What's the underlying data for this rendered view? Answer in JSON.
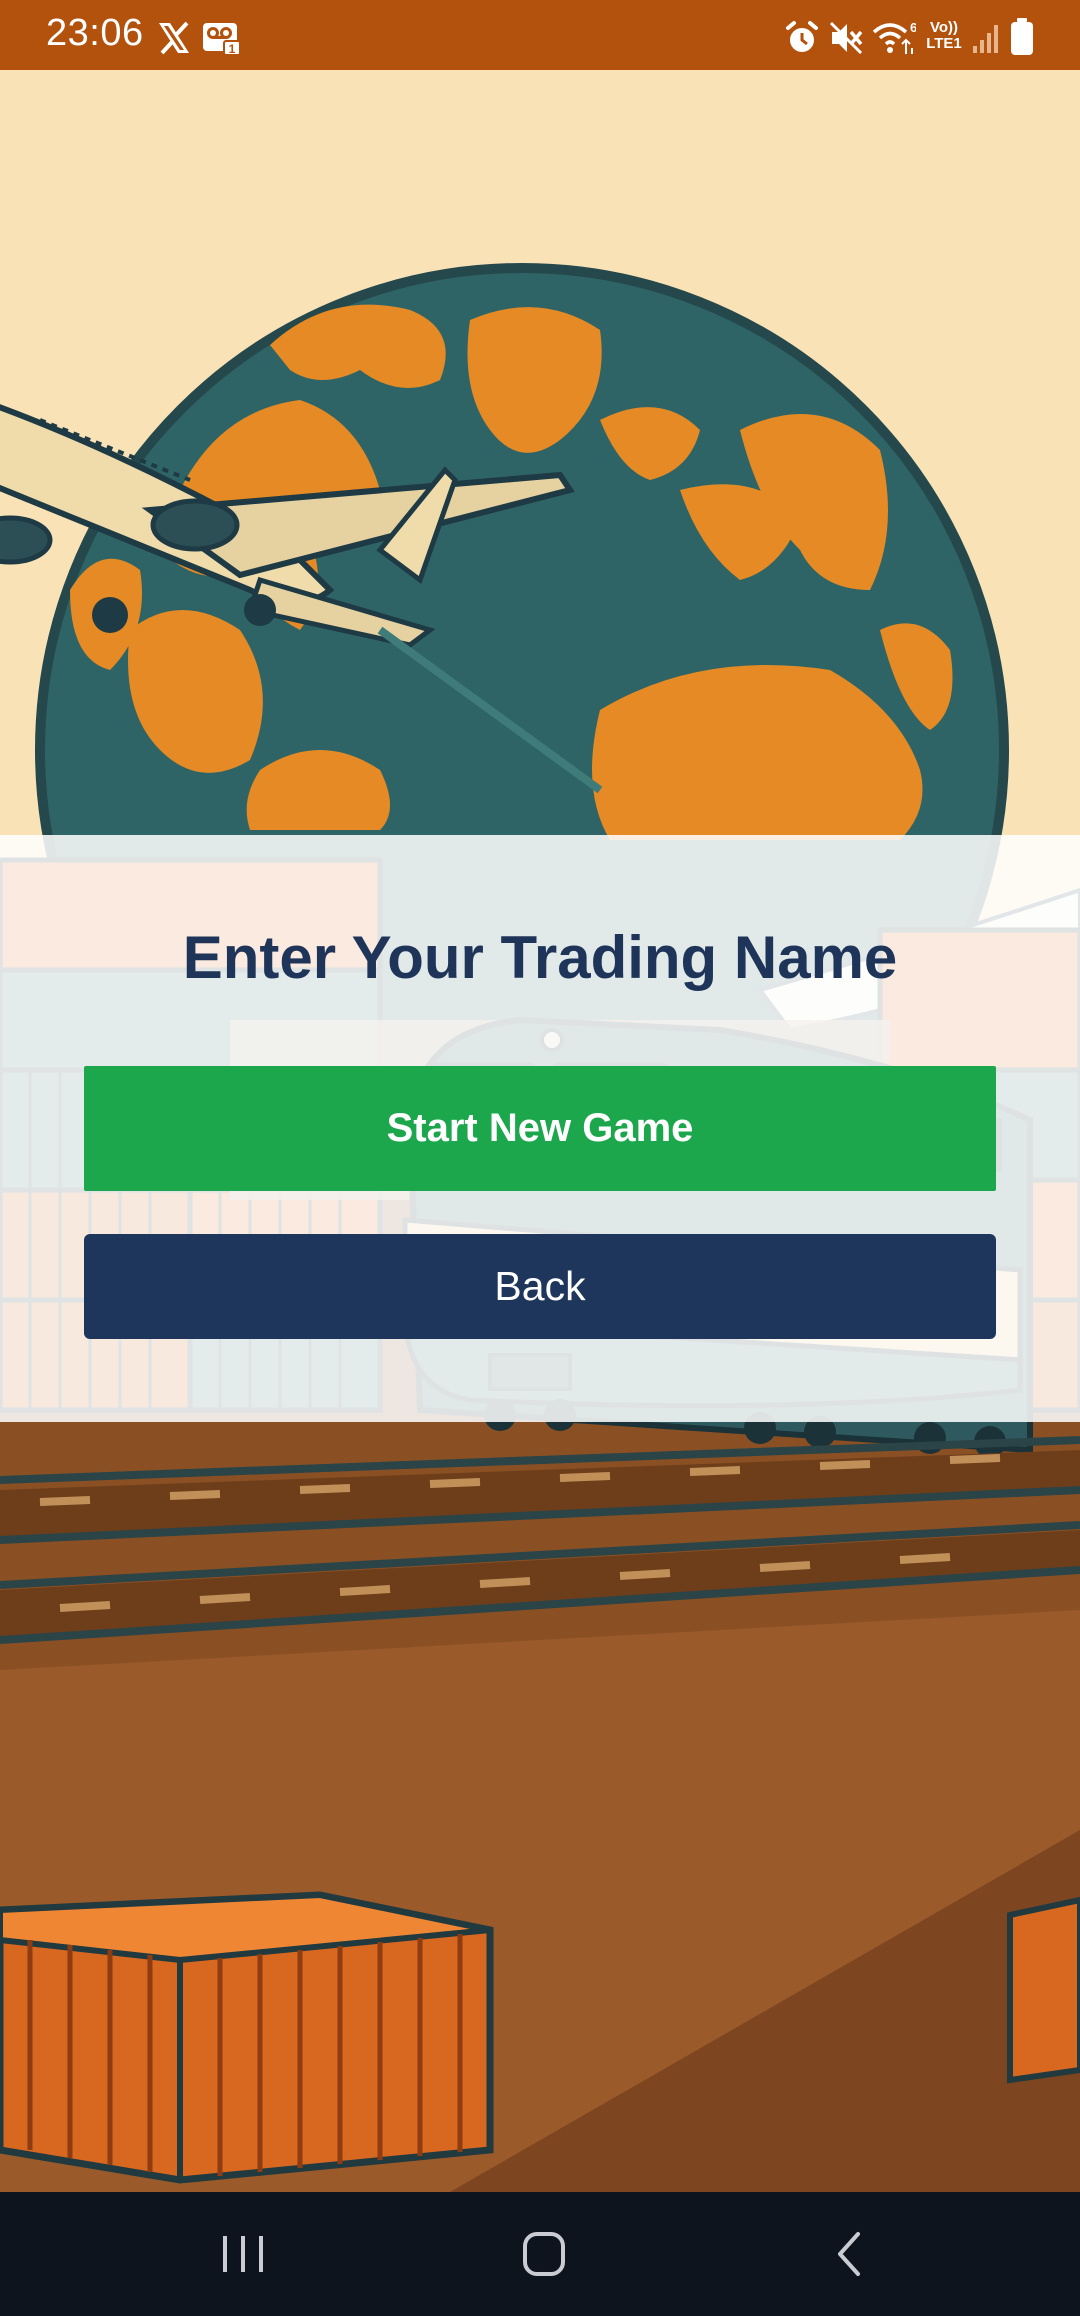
{
  "status_bar": {
    "time": "23:06",
    "left_icons": [
      "x-logo-icon",
      "voicemail-icon"
    ],
    "right_icons": [
      "alarm-icon",
      "mute-icon",
      "wifi-icon",
      "volte-icon",
      "signal-icon",
      "battery-icon"
    ],
    "wifi_badge": "6",
    "volte_line1": "Vo))",
    "volte_line2": "LTE1"
  },
  "form": {
    "title": "Enter Your Trading Name",
    "start_button": "Start New Game",
    "back_button": "Back"
  },
  "colors": {
    "status_bar": "#b3520d",
    "title": "#1f3459",
    "start_button": "#1ca74c",
    "back_button": "#1f365c",
    "nav_bar": "#0e141d"
  },
  "nav_bar": {
    "icons": [
      "recent-apps-icon",
      "home-icon",
      "back-nav-icon"
    ]
  }
}
